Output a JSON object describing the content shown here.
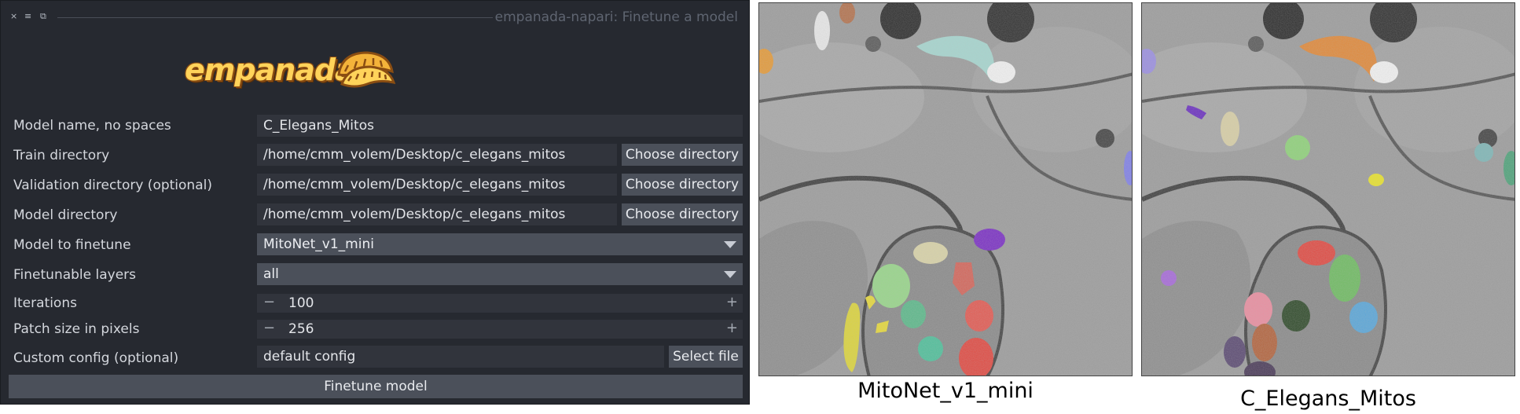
{
  "window": {
    "title": "empanada-napari: Finetune a model",
    "controls": [
      "×",
      "≡",
      "⧉"
    ]
  },
  "logo": {
    "text": "empanada"
  },
  "form": {
    "model_name": {
      "label": "Model name, no spaces",
      "value": "C_Elegans_Mitos"
    },
    "train_dir": {
      "label": "Train directory",
      "value": "/home/cmm_volem/Desktop/c_elegans_mitos",
      "button": "Choose directory"
    },
    "val_dir": {
      "label": "Validation directory (optional)",
      "value": "/home/cmm_volem/Desktop/c_elegans_mitos",
      "button": "Choose directory"
    },
    "model_dir": {
      "label": "Model directory",
      "value": "/home/cmm_volem/Desktop/c_elegans_mitos",
      "button": "Choose directory"
    },
    "model_to_finetune": {
      "label": "Model to finetune",
      "value": "MitoNet_v1_mini"
    },
    "finetunable_layers": {
      "label": "Finetunable layers",
      "value": "all"
    },
    "iterations": {
      "label": "Iterations",
      "value": "100",
      "minus": "−",
      "plus": "+"
    },
    "patch_size": {
      "label": "Patch size in pixels",
      "value": "256",
      "minus": "−",
      "plus": "+"
    },
    "custom_config": {
      "label": "Custom config (optional)",
      "value": "default config",
      "button": "Select file"
    },
    "submit": "Finetune model"
  },
  "panels": {
    "left_caption": "MitoNet_v1_mini",
    "right_caption": "C_Elegans_Mitos"
  },
  "colors": {
    "dialog_bg": "#262930",
    "button_bg": "#4b505a",
    "field_bg": "#31343c",
    "logo_yellow": "#ffd35a",
    "logo_brown": "#8a4d12"
  }
}
